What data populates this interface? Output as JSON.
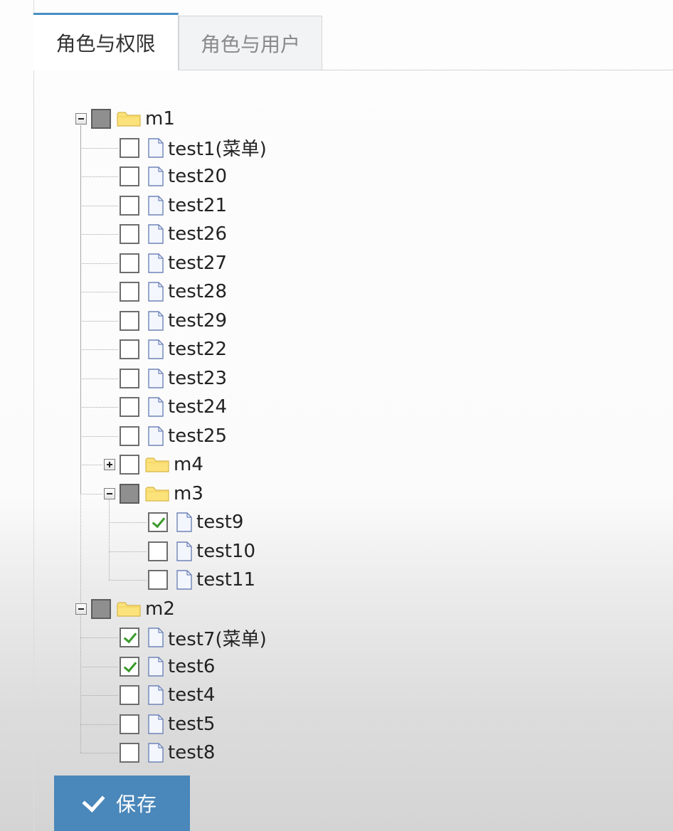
{
  "tabs": [
    {
      "label": "角色与权限",
      "active": true
    },
    {
      "label": "角色与用户",
      "active": false
    }
  ],
  "tree": [
    {
      "label": "m1",
      "type": "folder",
      "state": "partial",
      "expanded": true,
      "children": [
        {
          "label": "test1(菜单)",
          "type": "file",
          "state": "unchecked"
        },
        {
          "label": "test20",
          "type": "file",
          "state": "unchecked"
        },
        {
          "label": "test21",
          "type": "file",
          "state": "unchecked"
        },
        {
          "label": "test26",
          "type": "file",
          "state": "unchecked"
        },
        {
          "label": "test27",
          "type": "file",
          "state": "unchecked"
        },
        {
          "label": "test28",
          "type": "file",
          "state": "unchecked"
        },
        {
          "label": "test29",
          "type": "file",
          "state": "unchecked"
        },
        {
          "label": "test22",
          "type": "file",
          "state": "unchecked"
        },
        {
          "label": "test23",
          "type": "file",
          "state": "unchecked"
        },
        {
          "label": "test24",
          "type": "file",
          "state": "unchecked"
        },
        {
          "label": "test25",
          "type": "file",
          "state": "unchecked"
        },
        {
          "label": "m4",
          "type": "folder",
          "state": "unchecked",
          "expanded": false,
          "children": []
        },
        {
          "label": "m3",
          "type": "folder",
          "state": "partial",
          "expanded": true,
          "children": [
            {
              "label": "test9",
              "type": "file",
              "state": "checked"
            },
            {
              "label": "test10",
              "type": "file",
              "state": "unchecked"
            },
            {
              "label": "test11",
              "type": "file",
              "state": "unchecked"
            }
          ]
        }
      ]
    },
    {
      "label": "m2",
      "type": "folder",
      "state": "partial",
      "expanded": true,
      "children": [
        {
          "label": "test7(菜单)",
          "type": "file",
          "state": "checked"
        },
        {
          "label": "test6",
          "type": "file",
          "state": "checked"
        },
        {
          "label": "test4",
          "type": "file",
          "state": "unchecked"
        },
        {
          "label": "test5",
          "type": "file",
          "state": "unchecked"
        },
        {
          "label": "test8",
          "type": "file",
          "state": "unchecked"
        }
      ]
    }
  ],
  "save_button": {
    "label": "保存",
    "icon": "check-icon"
  },
  "colors": {
    "tab_accent": "#4a8fc4",
    "save_button": "#4a87ba",
    "check_mark": "#3b9a2c",
    "partial_fill": "#8f8f8f"
  }
}
